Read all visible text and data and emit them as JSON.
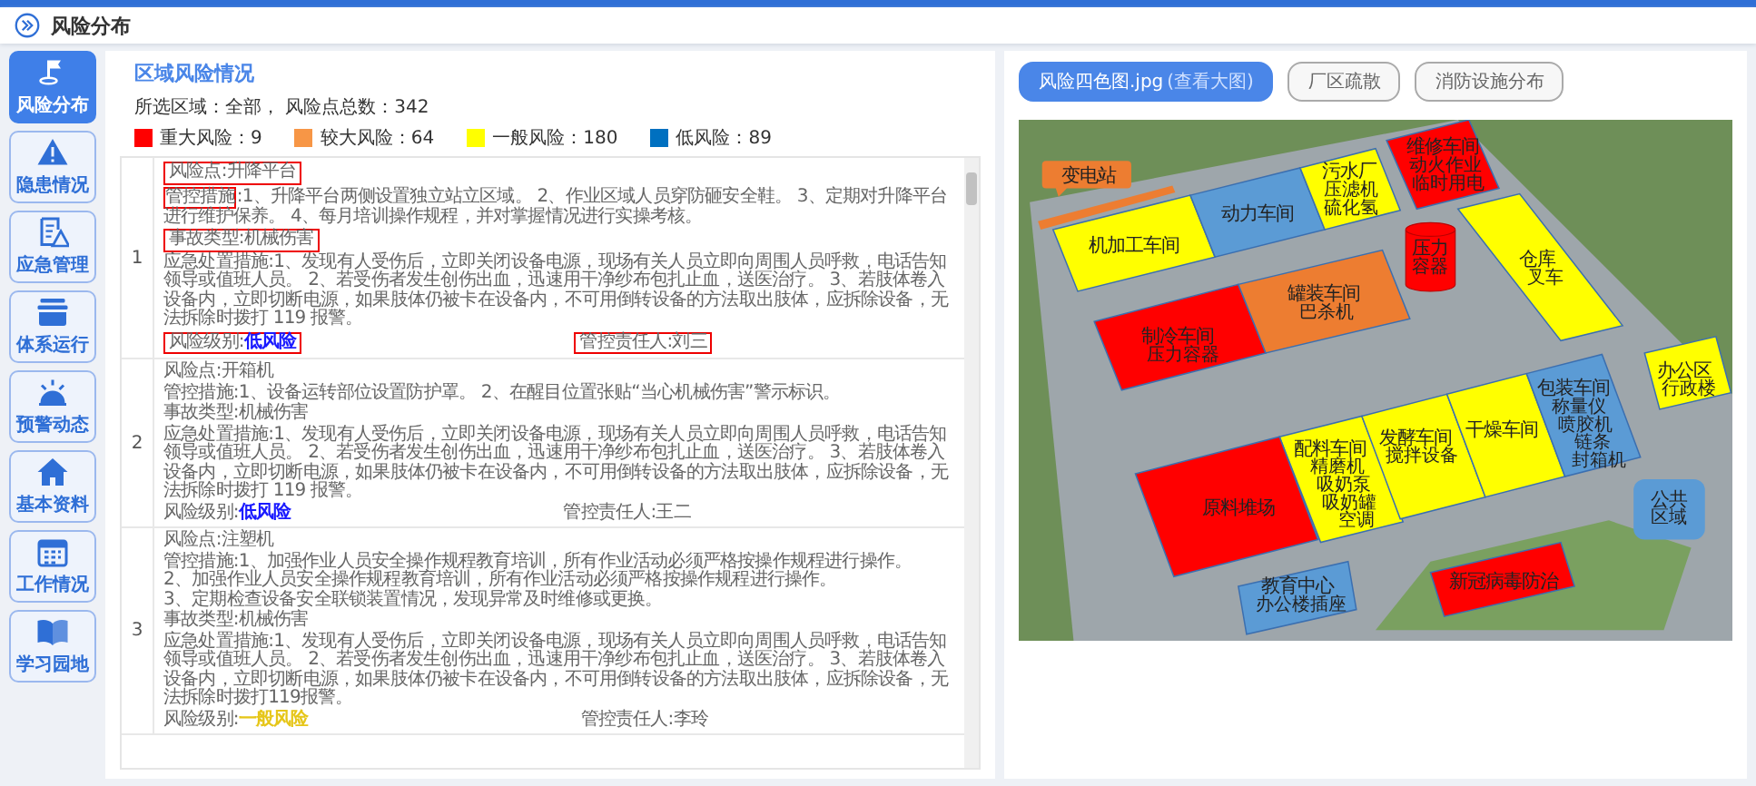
{
  "header": {
    "title": "风险分布"
  },
  "sidebar": {
    "items": [
      {
        "label": "风险分布",
        "selected": true
      },
      {
        "label": "隐患情况",
        "selected": false
      },
      {
        "label": "应急管理",
        "selected": false
      },
      {
        "label": "体系运行",
        "selected": false
      },
      {
        "label": "预警动态",
        "selected": false
      },
      {
        "label": "基本资料",
        "selected": false
      },
      {
        "label": "工作情况",
        "selected": false
      },
      {
        "label": "学习园地",
        "selected": false
      }
    ]
  },
  "risk_panel": {
    "title": "区域风险情况",
    "summary": "所选区域：全部， 风险点总数：342",
    "legend": [
      {
        "label": "重大风险：9",
        "color": "#ff0000"
      },
      {
        "label": "较大风险：64",
        "color": "#f79646"
      },
      {
        "label": "一般风险：180",
        "color": "#ffff00"
      },
      {
        "label": "低风险：89",
        "color": "#0070c0"
      }
    ],
    "rows": [
      {
        "number": "1",
        "fields": [
          {
            "label": "风险点",
            "text": ":升降平台",
            "highlighted": true
          },
          {
            "label": "管控措施",
            "text": ":1、升降平台两侧设置独立站立区域。 2、作业区域人员穿防砸安全鞋。 3、定期对升降平台进行维护保养。 4、每月培训操作规程，并对掌握情况进行实操考核。",
            "highlighted": true
          },
          {
            "label": "事故类型",
            "text": ":机械伤害",
            "highlighted": true
          },
          {
            "label": "应急处置措施",
            "text": ":1、发现有人受伤后，立即关闭设备电源，现场有关人员立即向周围人员呼救，电话告知领导或值班人员。 2、若受伤者发生创伤出血，迅速用干净纱布包扎止血，送医治疗。 3、若肢体卷入设备内，立即切断电源，如果肢体仍被卡在设备内，不可用倒转设备的方法取出肢体，应拆除设备，无法拆除时拨打 119 报警。",
            "highlighted": false
          }
        ],
        "level": {
          "label": "风险级别:",
          "value": "低风险",
          "color": "#1a1aff",
          "highlighted": true
        },
        "owner": {
          "text": "管控责任人:刘三",
          "highlighted": true
        }
      },
      {
        "number": "2",
        "fields": [
          {
            "label": "风险点",
            "text": ":开箱机",
            "highlighted": false
          },
          {
            "label": "管控措施",
            "text": ":1、设备运转部位设置防护罩。 2、在醒目位置张贴“当心机械伤害”警示标识。",
            "highlighted": false
          },
          {
            "label": "事故类型",
            "text": ":机械伤害",
            "highlighted": false
          },
          {
            "label": "应急处置措施",
            "text": ":1、发现有人受伤后，立即关闭设备电源，现场有关人员立即向周围人员呼救，电话告知领导或值班人员。 2、若受伤者发生创伤出血，迅速用干净纱布包扎止血，送医治疗。 3、若肢体卷入设备内，立即切断电源，如果肢体仍被卡在设备内，不可用倒转设备的方法取出肢体，应拆除设备，无法拆除时拨打 119 报警。",
            "highlighted": false
          }
        ],
        "level": {
          "label": "风险级别:",
          "value": "低风险",
          "color": "#1a1aff",
          "highlighted": false
        },
        "owner": {
          "text": "管控责任人:王二",
          "highlighted": false
        }
      },
      {
        "number": "3",
        "fields": [
          {
            "label": "风险点",
            "text": ":注塑机",
            "highlighted": false
          },
          {
            "label": "管控措施",
            "text": ":1、加强作业人员安全操作规程教育培训，所有作业活动必须严格按操作规程进行操作。\n2、加强作业人员安全操作规程教育培训，所有作业活动必须严格按操作规程进行操作。\n3、定期检查设备安全联锁装置情况，发现异常及时维修或更换。",
            "highlighted": false
          },
          {
            "label": "事故类型",
            "text": ":机械伤害",
            "highlighted": false
          },
          {
            "label": "应急处置措施",
            "text": ":1、发现有人受伤后，立即关闭设备电源，现场有关人员立即向周围人员呼救，电话告知领导或值班人员。 2、若受伤者发生创伤出血，迅速用干净纱布包扎止血，送医治疗。 3、若肢体卷入设备内，立即切断电源，如果肢体仍被卡在设备内，不可用倒转设备的方法取出肢体，应拆除设备，无法拆除时拨打119报警。",
            "highlighted": false
          }
        ],
        "level": {
          "label": "风险级别:",
          "value": "一般风险",
          "color": "#e6c619",
          "highlighted": false
        },
        "owner": {
          "text": "管控责任人:李玲",
          "highlighted": false
        }
      }
    ]
  },
  "map_panel": {
    "tabs": [
      {
        "label": "风险四色图.jpg",
        "hint": "(查看大图)",
        "selected": true
      },
      {
        "label": "厂区疏散",
        "selected": false
      },
      {
        "label": "消防设施分布",
        "selected": false
      }
    ],
    "zones": [
      {
        "kind": "callout",
        "lines": [
          "变电站"
        ],
        "color": "#ed7d31"
      },
      {
        "kind": "block",
        "lines": [
          "机加工车间"
        ],
        "color": "#ffff00"
      },
      {
        "kind": "block",
        "lines": [
          "动力车间"
        ],
        "color": "#5b9bd5"
      },
      {
        "kind": "block",
        "lines": [
          "污水厂",
          "压滤机",
          "硫化氢"
        ],
        "color": "#ffff00"
      },
      {
        "kind": "block",
        "lines": [
          "维修车间",
          "动火作业",
          "临时用电"
        ],
        "color": "#ff0000"
      },
      {
        "kind": "tank",
        "lines": [
          "压力",
          "容器"
        ],
        "color": "#ff0000"
      },
      {
        "kind": "block",
        "lines": [
          "仓库",
          "叉车"
        ],
        "color": "#ffff00"
      },
      {
        "kind": "block",
        "lines": [
          "制冷车间",
          "压力容器"
        ],
        "color": "#ff0000"
      },
      {
        "kind": "block",
        "lines": [
          "罐装车间",
          "巴杀机"
        ],
        "color": "#ed7d31"
      },
      {
        "kind": "block",
        "lines": [
          "配料车间",
          "精磨机",
          "吸奶泵",
          "吸奶罐",
          "空调"
        ],
        "color": "#ffff00"
      },
      {
        "kind": "block",
        "lines": [
          "发酵车间",
          "搅拌设备"
        ],
        "color": "#ffff00"
      },
      {
        "kind": "block",
        "lines": [
          "干燥车间"
        ],
        "color": "#ffff00"
      },
      {
        "kind": "block",
        "lines": [
          "包装车间",
          "称量仪",
          "喷胶机",
          "链条",
          "封箱机"
        ],
        "color": "#5b9bd5"
      },
      {
        "kind": "block",
        "lines": [
          "原料堆场"
        ],
        "color": "#ff0000"
      },
      {
        "kind": "area",
        "lines": [
          "公共",
          "区域"
        ],
        "color": "#5b9bd5"
      },
      {
        "kind": "block",
        "lines": [
          "办公区",
          "行政楼"
        ],
        "color": "#ffff00"
      },
      {
        "kind": "block",
        "lines": [
          "教育中心",
          "办公楼插座"
        ],
        "color": "#5b9bd5"
      },
      {
        "kind": "block",
        "lines": [
          "新冠病毒防治"
        ],
        "color": "#ff0000"
      }
    ]
  }
}
